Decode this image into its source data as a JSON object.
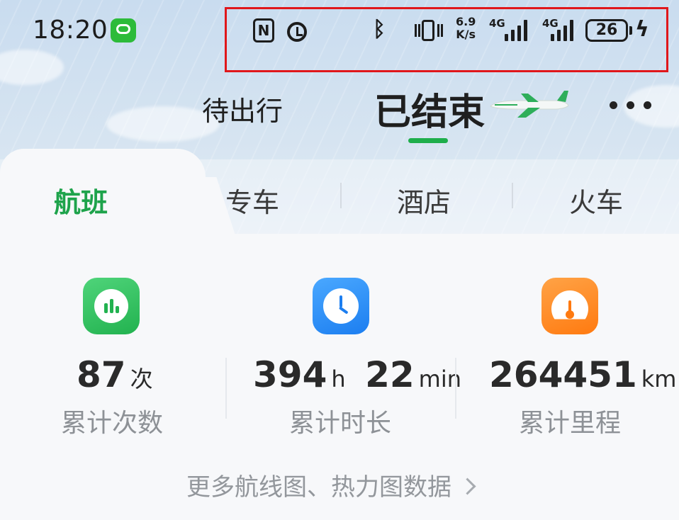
{
  "status_bar": {
    "time": "18:20",
    "nfc_label": "N",
    "speed_value": "6.9",
    "speed_unit": "K/s",
    "network1": "4G",
    "network2": "4G",
    "battery": "26",
    "icons": [
      "message-icon",
      "nfc-icon",
      "alarm-icon",
      "bluetooth-icon",
      "vibrate-icon",
      "signal-icon",
      "battery-icon",
      "charging-icon"
    ]
  },
  "header": {
    "tab_pending": "待出行",
    "tab_ended": "已结束",
    "accent_color": "#1eae4b"
  },
  "category_tabs": [
    {
      "label": "航班",
      "active": true
    },
    {
      "label": "专车",
      "active": false
    },
    {
      "label": "酒店",
      "active": false
    },
    {
      "label": "火车",
      "active": false
    }
  ],
  "stats": [
    {
      "value": "87",
      "unit": "次",
      "label": "累计次数",
      "icon": "chart-icon"
    },
    {
      "value_h": "394",
      "unit_h": "h",
      "value_m": "22",
      "unit_m": "min",
      "label": "累计时长",
      "icon": "clock-icon"
    },
    {
      "value": "264451",
      "unit": "km",
      "label": "累计里程",
      "icon": "speedometer-icon"
    }
  ],
  "more_link": "更多航线图、热力图数据"
}
